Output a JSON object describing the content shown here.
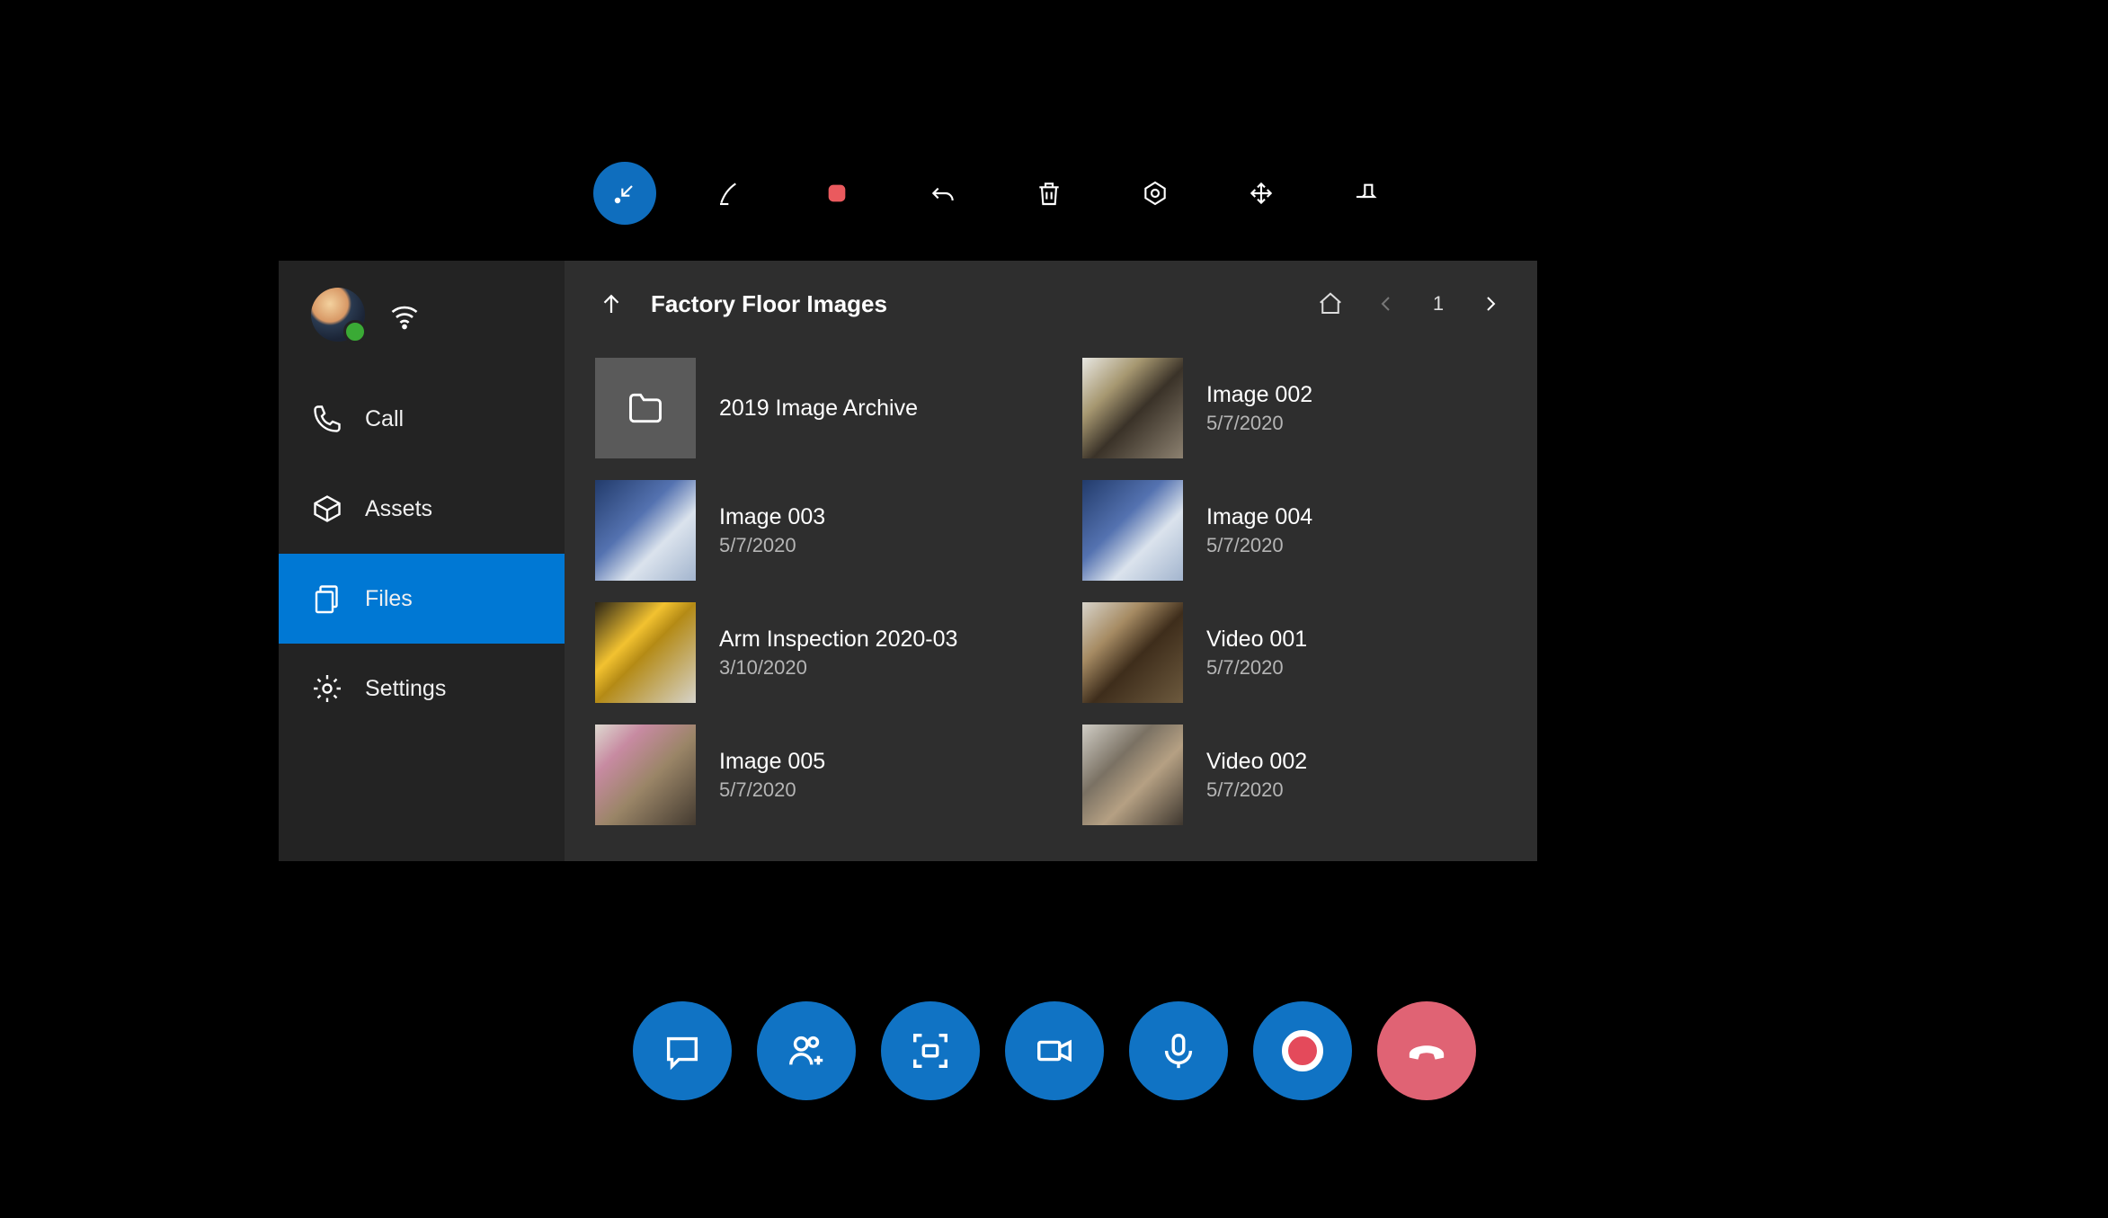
{
  "sidebar": {
    "items": [
      {
        "label": "Call"
      },
      {
        "label": "Assets"
      },
      {
        "label": "Files"
      },
      {
        "label": "Settings"
      }
    ]
  },
  "header": {
    "title": "Factory Floor Images",
    "page": "1"
  },
  "files": [
    {
      "name": "2019 Image Archive",
      "date": "",
      "type": "folder"
    },
    {
      "name": "Image 002",
      "date": "5/7/2020",
      "type": "image"
    },
    {
      "name": "Image 003",
      "date": "5/7/2020",
      "type": "image"
    },
    {
      "name": "Image 004",
      "date": "5/7/2020",
      "type": "image"
    },
    {
      "name": "Arm Inspection 2020-03",
      "date": "3/10/2020",
      "type": "image"
    },
    {
      "name": "Video 001",
      "date": "5/7/2020",
      "type": "video"
    },
    {
      "name": "Image 005",
      "date": "5/7/2020",
      "type": "image"
    },
    {
      "name": "Video 002",
      "date": "5/7/2020",
      "type": "video"
    }
  ]
}
